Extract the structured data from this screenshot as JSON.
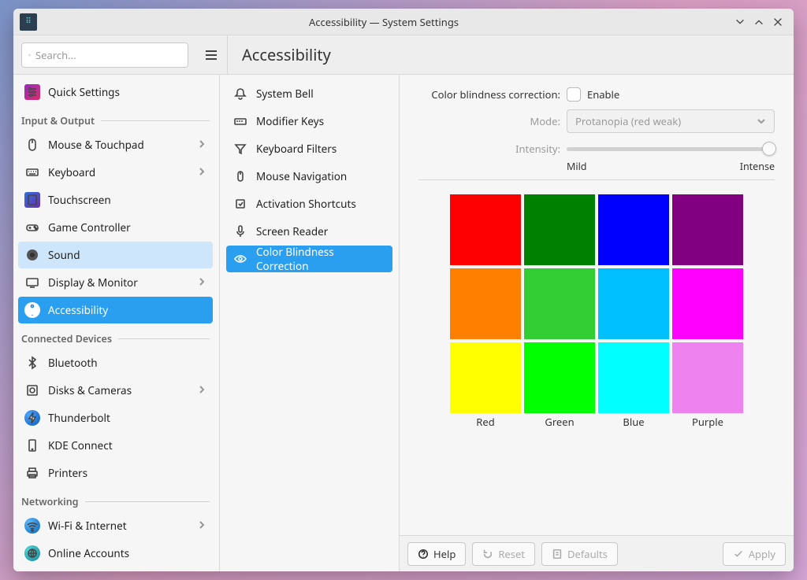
{
  "window": {
    "title": "Accessibility — System Settings"
  },
  "search": {
    "placeholder": "Search..."
  },
  "page": {
    "title": "Accessibility"
  },
  "sidebar": {
    "quick": "Quick Settings",
    "groups": [
      {
        "title": "Input & Output",
        "items": [
          {
            "label": "Mouse & Touchpad",
            "icon": "mouse",
            "chevron": true
          },
          {
            "label": "Keyboard",
            "icon": "keyboard",
            "chevron": true
          },
          {
            "label": "Touchscreen",
            "icon": "touchscreen",
            "chevron": false
          },
          {
            "label": "Game Controller",
            "icon": "gamepad",
            "chevron": false
          },
          {
            "label": "Sound",
            "icon": "sound",
            "chevron": false,
            "highlighted": true
          },
          {
            "label": "Display & Monitor",
            "icon": "display",
            "chevron": true
          },
          {
            "label": "Accessibility",
            "icon": "a11y",
            "chevron": false,
            "selected": true
          }
        ]
      },
      {
        "title": "Connected Devices",
        "items": [
          {
            "label": "Bluetooth",
            "icon": "bluetooth",
            "chevron": false
          },
          {
            "label": "Disks & Cameras",
            "icon": "disk",
            "chevron": true
          },
          {
            "label": "Thunderbolt",
            "icon": "thunderbolt",
            "chevron": false
          },
          {
            "label": "KDE Connect",
            "icon": "phone",
            "chevron": false
          },
          {
            "label": "Printers",
            "icon": "printer",
            "chevron": false
          }
        ]
      },
      {
        "title": "Networking",
        "items": [
          {
            "label": "Wi-Fi & Internet",
            "icon": "wifi",
            "chevron": true
          },
          {
            "label": "Online Accounts",
            "icon": "online",
            "chevron": false
          }
        ]
      }
    ]
  },
  "subnav": [
    {
      "label": "System Bell",
      "icon": "bell"
    },
    {
      "label": "Modifier Keys",
      "icon": "modkeys"
    },
    {
      "label": "Keyboard Filters",
      "icon": "filter"
    },
    {
      "label": "Mouse Navigation",
      "icon": "mousenav"
    },
    {
      "label": "Activation Shortcuts",
      "icon": "shortcut"
    },
    {
      "label": "Screen Reader",
      "icon": "mic"
    },
    {
      "label": "Color Blindness Correction",
      "icon": "eye",
      "selected": true
    }
  ],
  "form": {
    "correction_label": "Color blindness correction:",
    "enable_label": "Enable",
    "enable_checked": false,
    "mode_label": "Mode:",
    "mode_value": "Protanopia (red weak)",
    "intensity_label": "Intensity:",
    "intensity_min": "Mild",
    "intensity_max": "Intense",
    "intensity_value": 1.0
  },
  "swatches": {
    "labels": [
      "Red",
      "Green",
      "Blue",
      "Purple"
    ],
    "grid": [
      [
        "#ff0000",
        "#008000",
        "#0000ff",
        "#800080"
      ],
      [
        "#ff8000",
        "#32cd32",
        "#00bfff",
        "#ff00ff"
      ],
      [
        "#ffff00",
        "#00ff00",
        "#00ffff",
        "#ee82ee"
      ]
    ]
  },
  "footer": {
    "help": "Help",
    "reset": "Reset",
    "defaults": "Defaults",
    "apply": "Apply"
  }
}
